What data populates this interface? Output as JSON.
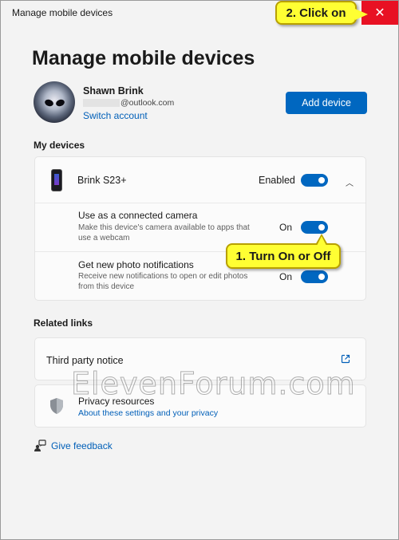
{
  "window": {
    "title": "Manage mobile devices"
  },
  "callouts": {
    "close": "2. Click on",
    "toggle": "1. Turn On or Off"
  },
  "page": {
    "heading": "Manage mobile devices"
  },
  "account": {
    "name": "Shawn Brink",
    "email_visible": "@outlook.com",
    "switch_label": "Switch account"
  },
  "buttons": {
    "add_device": "Add device"
  },
  "my_devices": {
    "section_label": "My devices",
    "device": {
      "name": "Brink S23+",
      "status": "Enabled",
      "enabled": true
    },
    "settings": [
      {
        "title": "Use as a connected camera",
        "description": "Make this device's camera available to apps that use a webcam",
        "state": "On",
        "on": true
      },
      {
        "title": "Get new photo notifications",
        "description": "Receive new notifications to open or edit photos from this device",
        "state": "On",
        "on": true
      }
    ]
  },
  "related": {
    "section_label": "Related links",
    "third_party": "Third party notice",
    "privacy_title": "Privacy resources",
    "privacy_link": "About these settings and your privacy"
  },
  "feedback": {
    "label": "Give feedback"
  },
  "watermark": "ElevenForum.com",
  "colors": {
    "accent": "#0067c0",
    "close": "#e81123",
    "callout": "#ffff33",
    "link": "#005fb8"
  },
  "icons": [
    "close-icon",
    "phone-icon",
    "chevron-up-icon",
    "external-link-icon",
    "shield-icon",
    "feedback-icon"
  ]
}
